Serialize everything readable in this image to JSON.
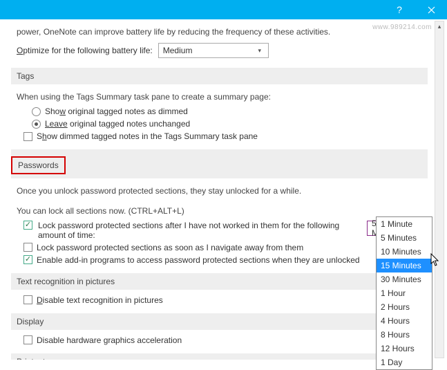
{
  "watermark": "www.989214.com",
  "battery": {
    "intro": "power, OneNote can improve battery life by reducing the frequency of these activities.",
    "label_pre": "O",
    "label_post": "ptimize for the following battery life:",
    "combo_value": "Medium"
  },
  "tags": {
    "header": "Tags",
    "desc": "When using the Tags Summary task pane to create a summary page:",
    "radio1_pre": "Sho",
    "radio1_u": "w",
    "radio1_post": " original tagged notes as dimmed",
    "radio2_pre": "Leave",
    "radio2_post": " original tagged notes unchanged",
    "cb_pre": "S",
    "cb_u": "h",
    "cb_post": "ow dimmed tagged notes in the Tags Summary task pane"
  },
  "passwords": {
    "header": "Passwords",
    "desc": "Once you unlock password protected sections, they stay unlocked for a while.",
    "hint": "You can lock all sections now. (CTRL+ALT+L)",
    "cb1": "Lock password protected sections after I have not worked in them for the following amount of time:",
    "cb2": "Lock password protected sections as soon as I navigate away from them",
    "cb3": "Enable add-in programs to access password protected sections when they are unlocked",
    "combo_value": "5 Minutes",
    "options": [
      "1 Minute",
      "5 Minutes",
      "10 Minutes",
      "15 Minutes",
      "30 Minutes",
      "1 Hour",
      "2 Hours",
      "4 Hours",
      "8 Hours",
      "12 Hours",
      "1 Day"
    ],
    "highlighted_option_index": 3
  },
  "textrec": {
    "header": "Text recognition in pictures",
    "cb_u": "D",
    "cb_post": "isable text recognition in pictures"
  },
  "display": {
    "header": "Display",
    "cb": "Disable hardware graphics acceleration"
  },
  "printouts": {
    "header": "Printouts"
  }
}
